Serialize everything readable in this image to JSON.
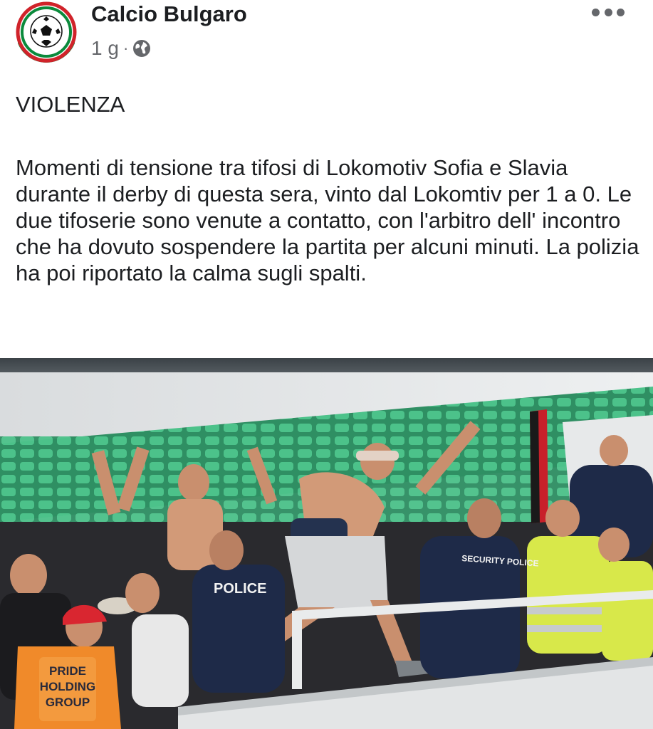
{
  "post": {
    "author": "Calcio Bulgaro",
    "time": "1 g",
    "separator": "·",
    "privacy_icon": "globe-icon",
    "more_icon": "more-dots-icon",
    "headline": "VIOLENZA",
    "body": "Momenti di tensione tra tifosi di Lokomotiv Sofia e Slavia durante il derby di questa sera, vinto dal Lokomtiv per 1 a 0. Le due tifoserie sono venute a contatto, con l'arbitro dell' incontro che ha dovuto sospendere la partita per alcuni minuti. La polizia ha poi riportato la calma sugli spalti."
  },
  "photo": {
    "vest_text_1": "PRIDE",
    "vest_text_2": "HOLDING",
    "vest_text_3": "GROUP",
    "police_label": "POLICE",
    "security_label": "SECURITY POLICE"
  },
  "colors": {
    "text_primary": "#1c1e21",
    "text_secondary": "#65676b",
    "seat_green": "#3fae7c",
    "vest_yellow": "#d8e84a",
    "vest_orange": "#f08a2a",
    "police_navy": "#1e2a48"
  }
}
